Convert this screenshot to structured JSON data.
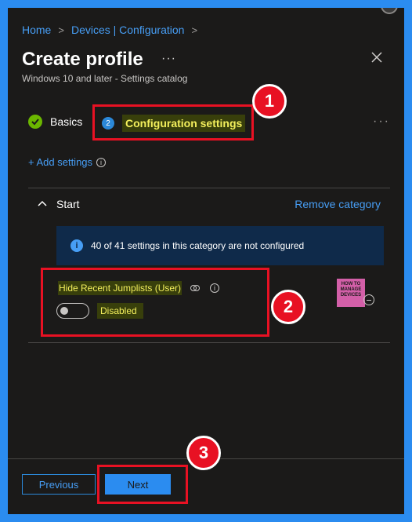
{
  "breadcrumb": [
    "Home",
    "Devices | Configuration"
  ],
  "page": {
    "title": "Create profile",
    "subtitle": "Windows 10 and later - Settings catalog"
  },
  "tabs": {
    "basics": "Basics",
    "config_step": "2",
    "config": "Configuration settings"
  },
  "add_settings": "+ Add settings",
  "category": {
    "name": "Start",
    "remove_label": "Remove category"
  },
  "info_bar": {
    "text": "40 of 41 settings in this category are not configured"
  },
  "setting": {
    "name": "Hide Recent Jumplists (User)",
    "toggle_label": "Disabled",
    "toggle_on": false
  },
  "logo": {
    "text": "HOW TO MANAGE DEVICES"
  },
  "footer": {
    "previous": "Previous",
    "next": "Next"
  },
  "annotations": [
    "1",
    "2",
    "3"
  ],
  "colors": {
    "accent": "#2b8cf0",
    "highlight": "#e81123",
    "success": "#6bb700"
  }
}
